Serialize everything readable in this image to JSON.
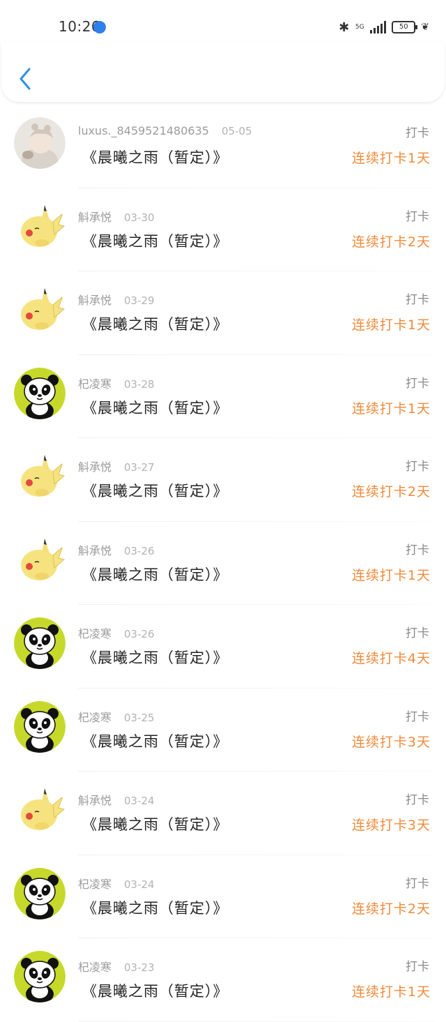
{
  "status_bar": {
    "time": "10:26",
    "network": "5G",
    "battery": "50",
    "icons": [
      "globe-icon",
      "bluetooth-icon",
      "signal-icon",
      "battery-icon",
      "leaf-icon"
    ]
  },
  "header": {
    "back_icon": "chevron-left-icon",
    "accent": "#2f8fe6"
  },
  "colors": {
    "streak": "#f08a3a",
    "meta": "#9c9c9c",
    "title": "#222222"
  },
  "records": [
    {
      "user": "luxus._8459521480635",
      "date": "05-05",
      "title": "《晨曦之雨（暂定）》",
      "tag": "打卡",
      "streak": "连续打卡1天",
      "avatar": "photo-avatar"
    },
    {
      "user": "斛承悦",
      "date": "03-30",
      "title": "《晨曦之雨（暂定）》",
      "tag": "打卡",
      "streak": "连续打卡2天",
      "avatar": "pikachu-avatar"
    },
    {
      "user": "斛承悦",
      "date": "03-29",
      "title": "《晨曦之雨（暂定）》",
      "tag": "打卡",
      "streak": "连续打卡1天",
      "avatar": "pikachu-avatar"
    },
    {
      "user": "杞凌寒",
      "date": "03-28",
      "title": "《晨曦之雨（暂定）》",
      "tag": "打卡",
      "streak": "连续打卡1天",
      "avatar": "panda-avatar"
    },
    {
      "user": "斛承悦",
      "date": "03-27",
      "title": "《晨曦之雨（暂定）》",
      "tag": "打卡",
      "streak": "连续打卡2天",
      "avatar": "pikachu-avatar"
    },
    {
      "user": "斛承悦",
      "date": "03-26",
      "title": "《晨曦之雨（暂定）》",
      "tag": "打卡",
      "streak": "连续打卡1天",
      "avatar": "pikachu-avatar"
    },
    {
      "user": "杞凌寒",
      "date": "03-26",
      "title": "《晨曦之雨（暂定）》",
      "tag": "打卡",
      "streak": "连续打卡4天",
      "avatar": "panda-avatar"
    },
    {
      "user": "杞凌寒",
      "date": "03-25",
      "title": "《晨曦之雨（暂定）》",
      "tag": "打卡",
      "streak": "连续打卡3天",
      "avatar": "panda-avatar"
    },
    {
      "user": "斛承悦",
      "date": "03-24",
      "title": "《晨曦之雨（暂定）》",
      "tag": "打卡",
      "streak": "连续打卡3天",
      "avatar": "pikachu-avatar"
    },
    {
      "user": "杞凌寒",
      "date": "03-24",
      "title": "《晨曦之雨（暂定）》",
      "tag": "打卡",
      "streak": "连续打卡2天",
      "avatar": "panda-avatar"
    },
    {
      "user": "杞凌寒",
      "date": "03-23",
      "title": "《晨曦之雨（暂定）》",
      "tag": "打卡",
      "streak": "连续打卡1天",
      "avatar": "panda-avatar"
    }
  ]
}
